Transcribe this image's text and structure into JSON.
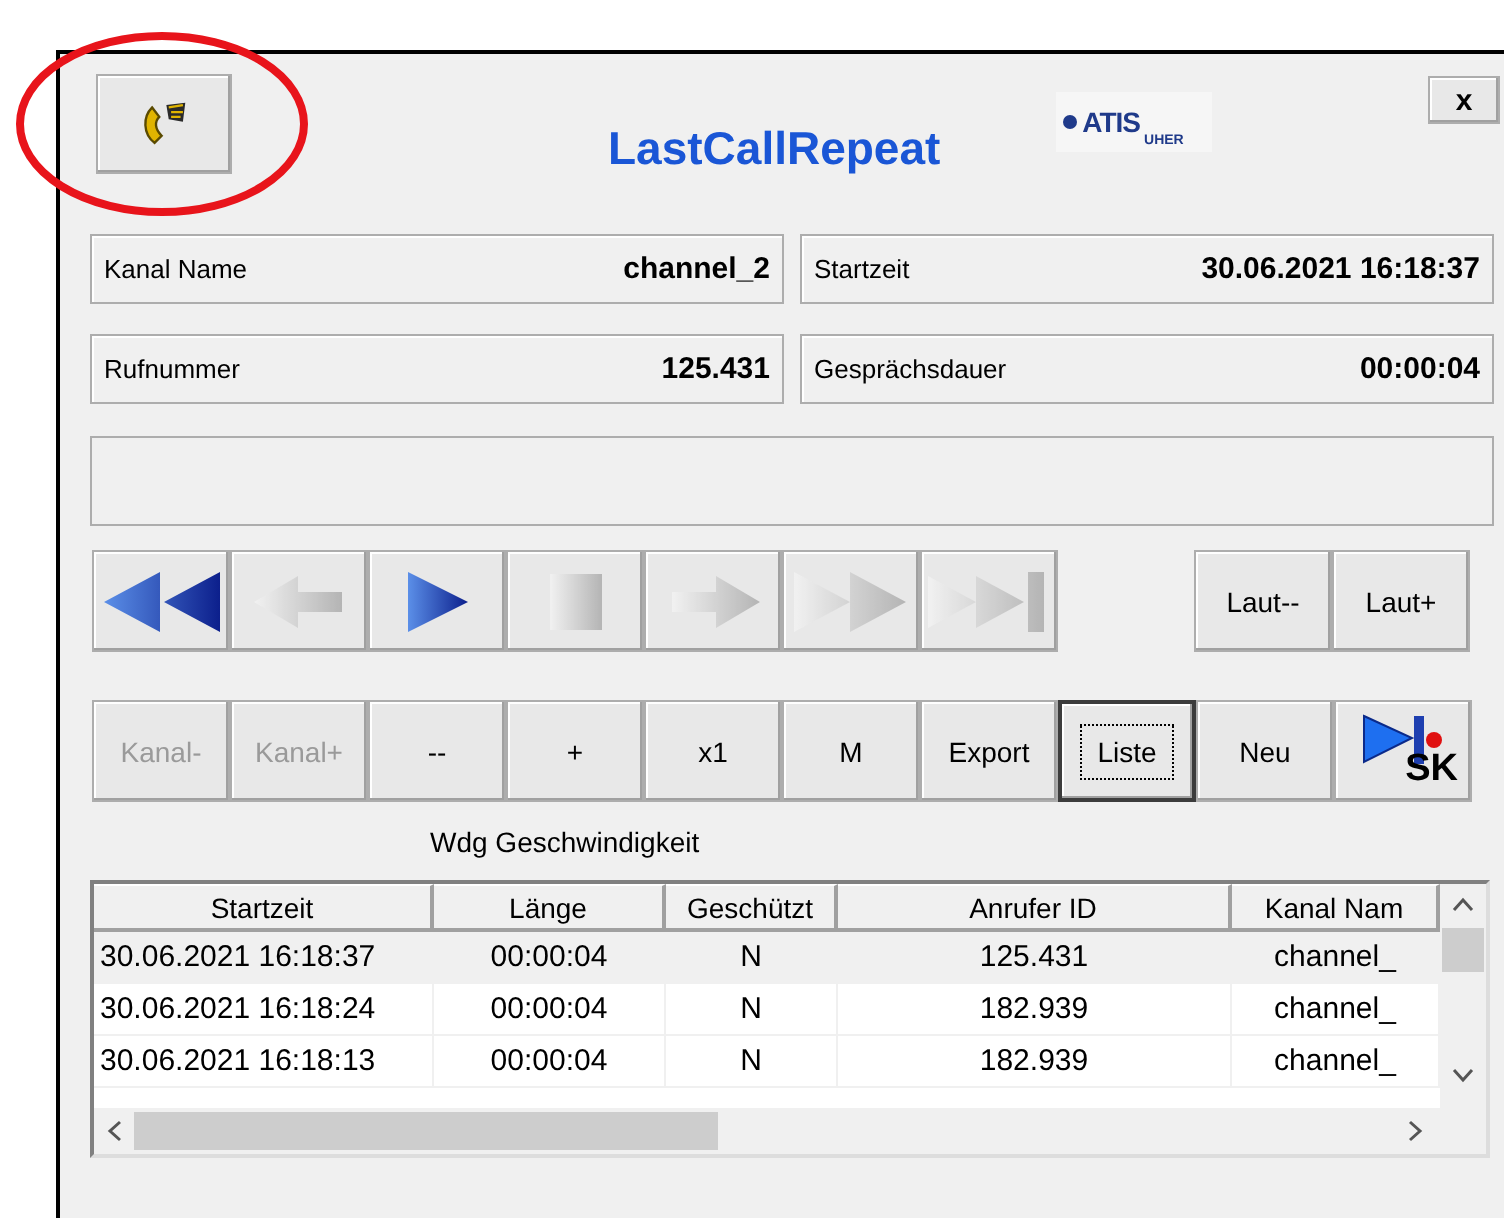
{
  "annotations": [
    {
      "kind": "ellipse"
    }
  ],
  "window": {
    "title": "LastCallRepeat",
    "close_label": "x",
    "logo": {
      "main": "ATIS",
      "sub": "UHER"
    }
  },
  "info": [
    {
      "label": "Kanal Name",
      "value": "channel_2"
    },
    {
      "label": "Startzeit",
      "value": "30.06.2021 16:18:37"
    },
    {
      "label": "Rufnummer",
      "value": "125.431"
    },
    {
      "label": "Gesprächsdauer",
      "value": "00:00:04"
    }
  ],
  "media_buttons": [
    {
      "kind": "rewind",
      "disabled": false
    },
    {
      "kind": "back",
      "disabled": true
    },
    {
      "kind": "play",
      "disabled": false
    },
    {
      "kind": "stop",
      "disabled": true
    },
    {
      "kind": "forward",
      "disabled": true
    },
    {
      "kind": "fast_forward",
      "disabled": true
    },
    {
      "kind": "end",
      "disabled": true
    }
  ],
  "volume_buttons": [
    {
      "label": "Laut--",
      "disabled": false
    },
    {
      "label": "Laut+",
      "disabled": false
    }
  ],
  "control_buttons": [
    {
      "kind": "text",
      "label": "Kanal-",
      "disabled": true,
      "focused": false
    },
    {
      "kind": "text",
      "label": "Kanal+",
      "disabled": true,
      "focused": false
    },
    {
      "kind": "text",
      "label": "--",
      "disabled": false,
      "focused": false
    },
    {
      "kind": "text",
      "label": "+",
      "disabled": false,
      "focused": false
    },
    {
      "kind": "text",
      "label": "x1",
      "disabled": false,
      "focused": false
    },
    {
      "kind": "text",
      "label": "M",
      "disabled": false,
      "focused": false
    },
    {
      "kind": "text",
      "label": "Export",
      "disabled": false,
      "focused": false
    },
    {
      "kind": "text",
      "label": "Liste",
      "disabled": false,
      "focused": true
    },
    {
      "kind": "text",
      "label": "Neu",
      "disabled": false,
      "focused": false
    },
    {
      "kind": "sk",
      "label": "SK",
      "disabled": false,
      "focused": false
    }
  ],
  "speed_label": "Wdg Geschwindigkeit",
  "table": {
    "columns": [
      "Startzeit",
      "Länge",
      "Geschützt",
      "Anrufer ID",
      "Kanal Nam"
    ],
    "rows": [
      {
        "cells": [
          "30.06.2021 16:18:37",
          "00:00:04",
          "N",
          "125.431",
          "channel_"
        ],
        "selected": true
      },
      {
        "cells": [
          "30.06.2021 16:18:24",
          "00:00:04",
          "N",
          "182.939",
          "channel_"
        ],
        "selected": false
      },
      {
        "cells": [
          "30.06.2021 16:18:13",
          "00:00:04",
          "N",
          "182.939",
          "channel_"
        ],
        "selected": false
      }
    ]
  }
}
